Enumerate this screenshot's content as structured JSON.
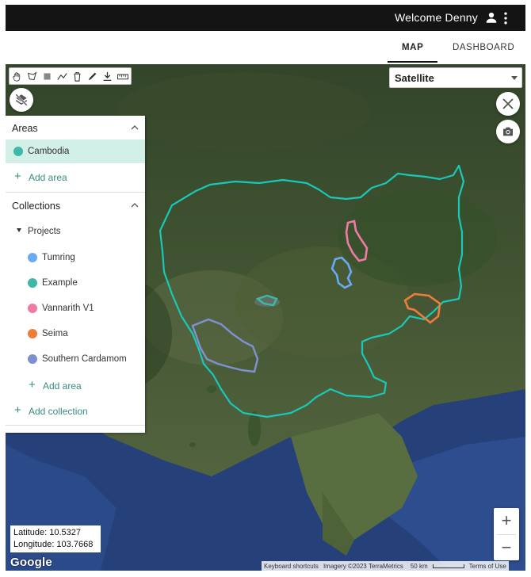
{
  "header": {
    "welcome": "Welcome Denny",
    "user_icon": "account-icon",
    "menu_icon": "more-vert-icon"
  },
  "tabs": [
    {
      "label": "MAP",
      "active": true
    },
    {
      "label": "DASHBOARD",
      "active": false
    }
  ],
  "map": {
    "basemap_selected": "Satellite",
    "toolbar_icons": [
      "pan-hand-icon",
      "polygon-icon",
      "rectangle-icon",
      "line-icon",
      "delete-icon",
      "edit-icon",
      "download-icon",
      "ruler-icon"
    ],
    "latitude_label": "Latitude: 10.5327",
    "longitude_label": "Longitude: 103.7668",
    "logo": "Google",
    "attribution": {
      "shortcuts": "Keyboard shortcuts",
      "imagery": "Imagery ©2023 TerraMetrics",
      "scale": "50 km",
      "terms": "Terms of Use"
    },
    "zoom_in": "+",
    "zoom_out": "−"
  },
  "panel": {
    "areas_title": "Areas",
    "areas": [
      {
        "label": "Cambodia",
        "color": "#3fb8a8",
        "selected": true
      }
    ],
    "add_area": "Add area",
    "collections_title": "Collections",
    "projects_label": "Projects",
    "collection_items": [
      {
        "label": "Tumring",
        "color": "#6aaaf5"
      },
      {
        "label": "Example",
        "color": "#3fb8a8"
      },
      {
        "label": "Vannarith V1",
        "color": "#f07aa6"
      },
      {
        "label": "Seima",
        "color": "#ef7d3a"
      },
      {
        "label": "Southern Cardamom",
        "color": "#7d90cf"
      }
    ],
    "add_area_projects": "Add area",
    "add_collection": "Add collection"
  },
  "colors": {
    "cambodia_outline": "#19c9b8",
    "tumring": "#6aaaf5",
    "example": "#3fb8a8",
    "vannarith": "#f07aa6",
    "seima": "#ef7d3a",
    "cardamom": "#8091d3",
    "accent": "#3a8c7e"
  }
}
